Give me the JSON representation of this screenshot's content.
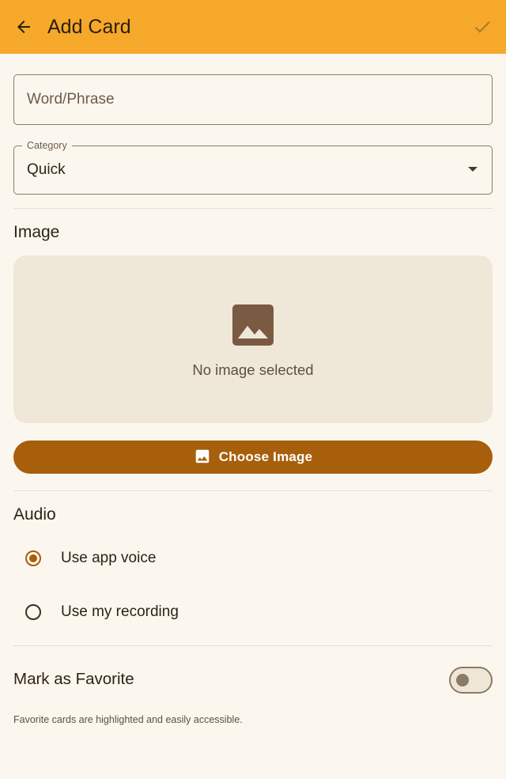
{
  "appbar": {
    "title": "Add Card",
    "back_icon": "arrow-back-icon",
    "save_icon": "check-icon",
    "color": "#f6a82a"
  },
  "form": {
    "word_placeholder": "Word/Phrase",
    "word_value": "",
    "category_label": "Category",
    "category_value": "Quick"
  },
  "image_section": {
    "title": "Image",
    "placeholder_icon": "image-icon",
    "empty_text": "No image selected",
    "choose_button": "Choose Image",
    "button_color": "#a75f0c"
  },
  "audio_section": {
    "title": "Audio",
    "options": [
      {
        "label": "Use app voice",
        "selected": true
      },
      {
        "label": "Use my recording",
        "selected": false
      }
    ]
  },
  "favorite": {
    "title": "Mark as Favorite",
    "enabled": false,
    "hint": "Favorite cards are highlighted and easily accessible."
  }
}
